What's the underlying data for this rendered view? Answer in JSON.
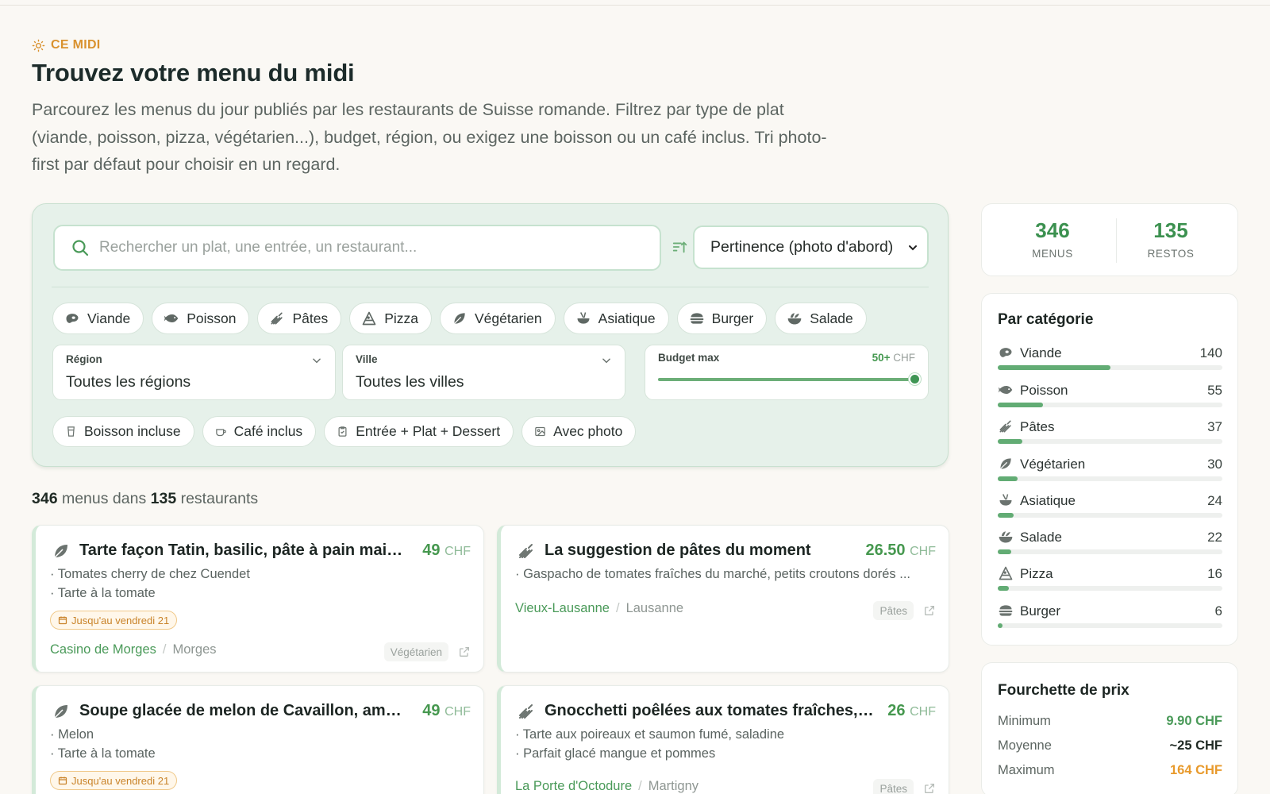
{
  "header": {
    "eyebrow": "CE MIDI",
    "title": "Trouvez votre menu du midi",
    "description": "Parcourez les menus du jour publiés par les restaurants de Suisse romande. Filtrez par type de plat (viande, poisson, pizza, végétarien...), budget, région, ou exigez une boisson ou un café inclus. Tri photo-first par défaut pour choisir en un regard."
  },
  "search": {
    "placeholder": "Rechercher un plat, une entrée, un restaurant...",
    "value": ""
  },
  "sort": {
    "selected": "Pertinence (photo d'abord)"
  },
  "categories": [
    {
      "label": "Viande",
      "icon": "steak-icon"
    },
    {
      "label": "Poisson",
      "icon": "fish-icon"
    },
    {
      "label": "Pâtes",
      "icon": "pasta-icon"
    },
    {
      "label": "Pizza",
      "icon": "pizza-icon"
    },
    {
      "label": "Végétarien",
      "icon": "leaf-icon"
    },
    {
      "label": "Asiatique",
      "icon": "bowl-icon"
    },
    {
      "label": "Burger",
      "icon": "burger-icon"
    },
    {
      "label": "Salade",
      "icon": "salad-icon"
    }
  ],
  "filters": {
    "region": {
      "label": "Région",
      "value": "Toutes les régions"
    },
    "city": {
      "label": "Ville",
      "value": "Toutes les villes"
    },
    "budget": {
      "label": "Budget max",
      "value": "50+",
      "unit": "CHF",
      "level": 1.0
    }
  },
  "options": [
    {
      "label": "Boisson incluse",
      "icon": "cup-icon"
    },
    {
      "label": "Café inclus",
      "icon": "coffee-icon"
    },
    {
      "label": "Entrée + Plat + Dessert",
      "icon": "clipboard-icon"
    },
    {
      "label": "Avec photo",
      "icon": "image-icon"
    }
  ],
  "results": {
    "menus": "346",
    "menus_text": "menus dans",
    "restos": "135",
    "restos_text": "restaurants"
  },
  "cards": [
    {
      "title": "Tarte façon Tatin, basilic, pâte à pain maison",
      "price": "49",
      "currency": "CHF",
      "lines": [
        "· Tomates cherry de chez Cuendet",
        "· Tarte à la tomate"
      ],
      "badge": "Jusqu'au vendredi 21",
      "restaurant": "Casino de Morges",
      "city": "Morges",
      "tag": "Végétarien"
    },
    {
      "title": "La suggestion de pâtes du moment",
      "price": "26.50",
      "currency": "CHF",
      "lines": [
        "· Gaspacho de tomates fraîches du marché, petits croutons dorés ..."
      ],
      "badge": "",
      "restaurant": "Vieux-Lausanne",
      "city": "Lausanne",
      "tag": "Pâtes"
    },
    {
      "title": "Soupe glacée de melon de Cavaillon, aman...",
      "price": "49",
      "currency": "CHF",
      "lines": [
        "· Melon",
        "· Tarte à la tomate"
      ],
      "badge": "Jusqu'au vendredi 21",
      "restaurant": "",
      "city": "",
      "tag": ""
    },
    {
      "title": "Gnocchetti poêlées aux tomates fraîches, b...",
      "price": "26",
      "currency": "CHF",
      "lines": [
        "· Tarte aux poireaux et saumon fumé, saladine",
        "· Parfait glacé mangue et pommes"
      ],
      "badge": "",
      "restaurant": "La Porte d'Octodure",
      "city": "Martigny",
      "tag": "Pâtes"
    }
  ],
  "stats": {
    "menus": "346",
    "menus_label": "MENUS",
    "restos": "135",
    "restos_label": "RESTOS"
  },
  "by_category": {
    "title": "Par catégorie",
    "rows": [
      {
        "label": "Viande",
        "count": "140",
        "share": 0.5
      },
      {
        "label": "Poisson",
        "count": "55",
        "share": 0.2
      },
      {
        "label": "Pâtes",
        "count": "37",
        "share": 0.11
      },
      {
        "label": "Végétarien",
        "count": "30",
        "share": 0.09
      },
      {
        "label": "Asiatique",
        "count": "24",
        "share": 0.07
      },
      {
        "label": "Salade",
        "count": "22",
        "share": 0.06
      },
      {
        "label": "Pizza",
        "count": "16",
        "share": 0.05
      },
      {
        "label": "Burger",
        "count": "6",
        "share": 0.02
      }
    ]
  },
  "price_range": {
    "title": "Fourchette de prix",
    "min_label": "Minimum",
    "min": "9.90 CHF",
    "avg_label": "Moyenne",
    "avg": "~25 CHF",
    "max_label": "Maximum",
    "max": "164 CHF"
  },
  "colors": {
    "accent": "#3c9150",
    "warning": "#d9922f",
    "panel": "#e6f1ea"
  }
}
